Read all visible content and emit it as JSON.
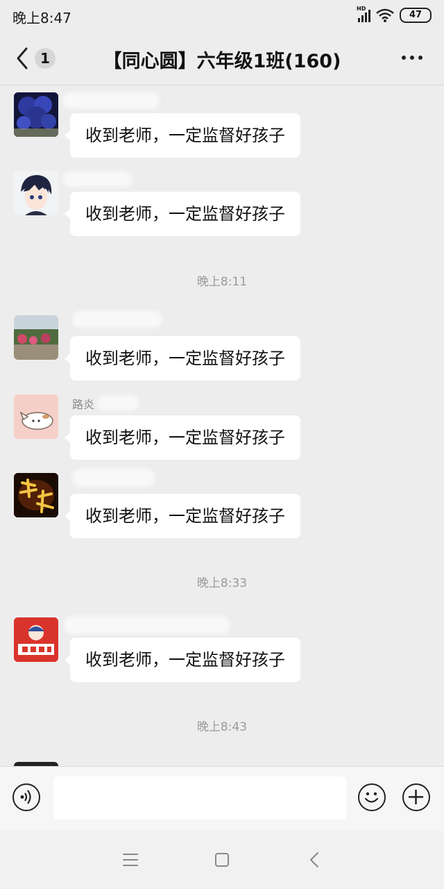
{
  "status_bar": {
    "time": "晚上8:47",
    "network": "HD",
    "battery": "47",
    "icons": [
      "signal-icon",
      "wifi-icon",
      "battery-icon"
    ]
  },
  "header": {
    "back_icon": "chevron-left-icon",
    "unread_count": "1",
    "title": "【同心圆】六年级1班(160)",
    "more_icon": "more-dots-icon"
  },
  "messages": [
    {
      "sender": "",
      "text": "收到老师，一定监督好孩子",
      "avatar": "flowers-avatar"
    },
    {
      "sender": "",
      "text": "收到老师，一定监督好孩子",
      "avatar": "anime-boy-avatar"
    },
    {
      "time": "晚上8:11"
    },
    {
      "sender": "",
      "text": "收到老师，一定监督好孩子",
      "avatar": "garden-photo-avatar"
    },
    {
      "sender": "路炎",
      "text": "收到老师，一定监督好孩子",
      "avatar": "cat-sticker-avatar"
    },
    {
      "sender": "",
      "text": "收到老师，一定监督好孩子",
      "avatar": "dream-calligraphy-avatar"
    },
    {
      "time": "晚上8:33"
    },
    {
      "sender": "",
      "text": "收到老师，一定监督好孩子",
      "avatar": "red-greeting-avatar"
    },
    {
      "time": "晚上8:43"
    }
  ],
  "input_bar": {
    "voice_icon": "voice-icon",
    "text_value": "",
    "emoji_icon": "emoji-icon",
    "plus_icon": "plus-icon"
  },
  "system_nav": {
    "menu_icon": "menu-icon",
    "home_icon": "home-icon",
    "back_icon": "back-triangle-icon"
  },
  "colors": {
    "background": "#ededed",
    "bubble": "#ffffff",
    "time_label": "#9a9a9a"
  }
}
